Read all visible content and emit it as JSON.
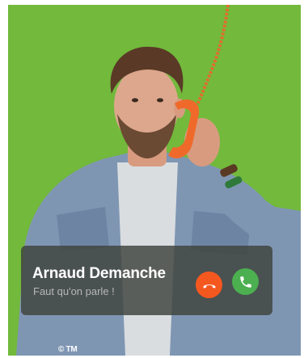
{
  "call": {
    "caller_name": "Arnaud Demanche",
    "subtitle": "Faut qu'on parle !",
    "decline_icon": "phone-hangup-icon",
    "accept_icon": "phone-icon",
    "decline_color": "#f5581f",
    "accept_color": "#4caf50"
  },
  "background_color": "#72b93c",
  "copyright": "© TM"
}
